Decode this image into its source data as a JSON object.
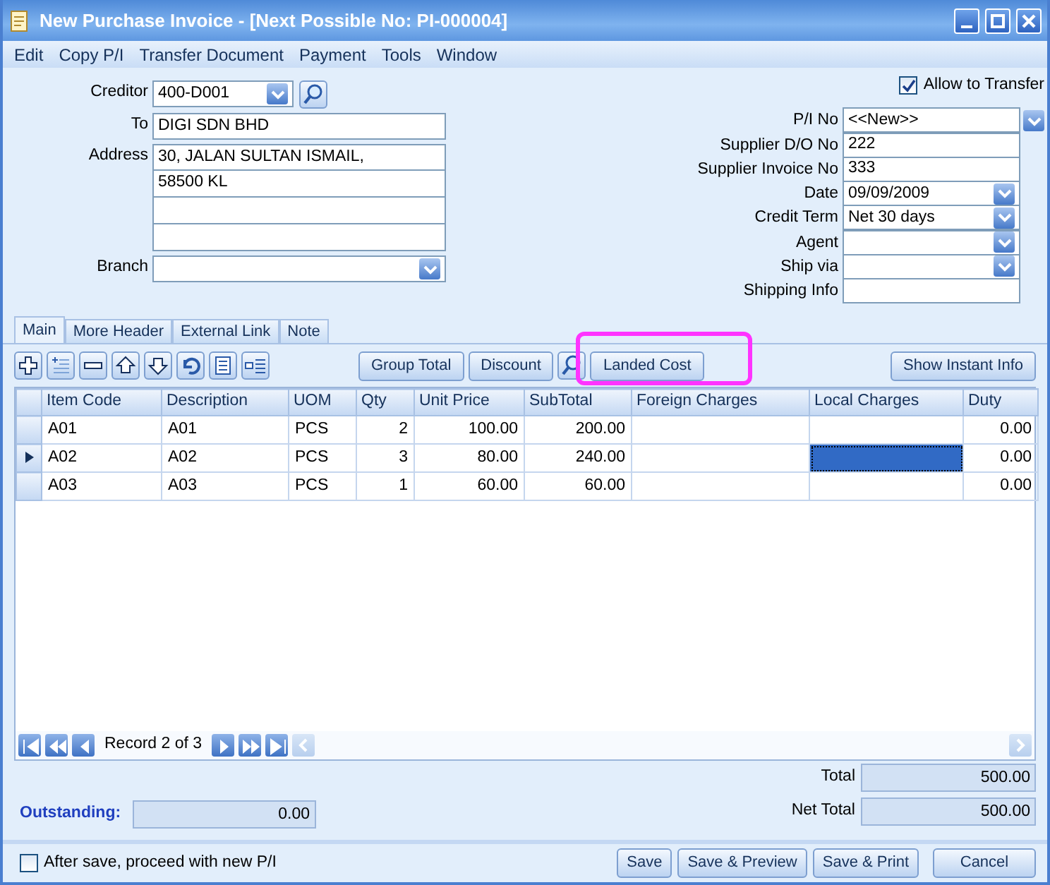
{
  "window": {
    "title": "New Purchase Invoice - [Next Possible No: PI-000004]"
  },
  "menu": [
    "Edit",
    "Copy P/I",
    "Transfer Document",
    "Payment",
    "Tools",
    "Window"
  ],
  "header_left": {
    "creditor": {
      "label": "Creditor",
      "value": "400-D001"
    },
    "to": {
      "label": "To",
      "value": "DIGI SDN BHD"
    },
    "address": {
      "label": "Address",
      "lines": [
        "30, JALAN SULTAN ISMAIL,",
        "58500 KL"
      ]
    },
    "branch": {
      "label": "Branch"
    }
  },
  "allow_to_transfer": {
    "label": "Allow to Transfer",
    "checked": true
  },
  "header_right": [
    {
      "label": "P/I No",
      "value": "<<New>>",
      "kind": "detached"
    },
    {
      "label": "Supplier D/O No",
      "value": "222",
      "kind": "text"
    },
    {
      "label": "Supplier Invoice No",
      "value": "333",
      "kind": "text"
    },
    {
      "label": "Date",
      "value": "09/09/2009",
      "kind": "dropdown"
    },
    {
      "label": "Credit Term",
      "value": "Net 30 days",
      "kind": "dropdown"
    },
    {
      "label": "Agent",
      "kind": "dropdown"
    },
    {
      "label": "Ship via",
      "kind": "dropdown"
    },
    {
      "label": "Shipping Info",
      "kind": "text"
    }
  ],
  "tabs": [
    {
      "label": "Main",
      "selected": true
    },
    {
      "label": "More Header",
      "selected": false
    },
    {
      "label": "External Link",
      "selected": false
    },
    {
      "label": "Note",
      "selected": false
    }
  ],
  "toolbar_buttons": [
    {
      "label": "Group Total",
      "highlighted": false
    },
    {
      "label": "Discount",
      "highlighted": false
    },
    {
      "label": "Landed Cost",
      "highlighted": true
    }
  ],
  "instant_info_button": "Show Instant Info",
  "grid": {
    "columns": [
      {
        "label": "Item Code",
        "focused": false
      },
      {
        "label": "Description",
        "focused": false
      },
      {
        "label": "UOM",
        "focused": false
      },
      {
        "label": "Qty",
        "focused": false
      },
      {
        "label": "Unit Price",
        "focused": false
      },
      {
        "label": "SubTotal",
        "focused": false
      },
      {
        "label": "Foreign Charges",
        "focused": false
      },
      {
        "label": "Local Charges",
        "focused": true
      },
      {
        "label": "Duty",
        "focused": false
      }
    ],
    "rows": [
      {
        "selected": false,
        "cells": [
          "A01",
          "A01",
          "PCS",
          "2",
          "100.00",
          "200.00",
          "",
          "",
          "0.00"
        ]
      },
      {
        "selected": true,
        "cells": [
          "A02",
          "A02",
          "PCS",
          "3",
          "80.00",
          "240.00",
          "",
          "",
          "0.00"
        ]
      },
      {
        "selected": false,
        "cells": [
          "A03",
          "A03",
          "PCS",
          "1",
          "60.00",
          "60.00",
          "",
          "",
          "0.00"
        ]
      }
    ]
  },
  "navigator": {
    "record": "Record 2 of 3"
  },
  "outstanding": {
    "label": "Outstanding:",
    "value": "0.00"
  },
  "totals": [
    {
      "label": "Total",
      "value": "500.00"
    },
    {
      "label": "Net Total",
      "value": "500.00"
    }
  ],
  "proceed_new": {
    "label": "After save, proceed with new P/I",
    "checked": false
  },
  "buttons": [
    "Save",
    "Save & Preview",
    "Save & Print",
    "Cancel"
  ]
}
